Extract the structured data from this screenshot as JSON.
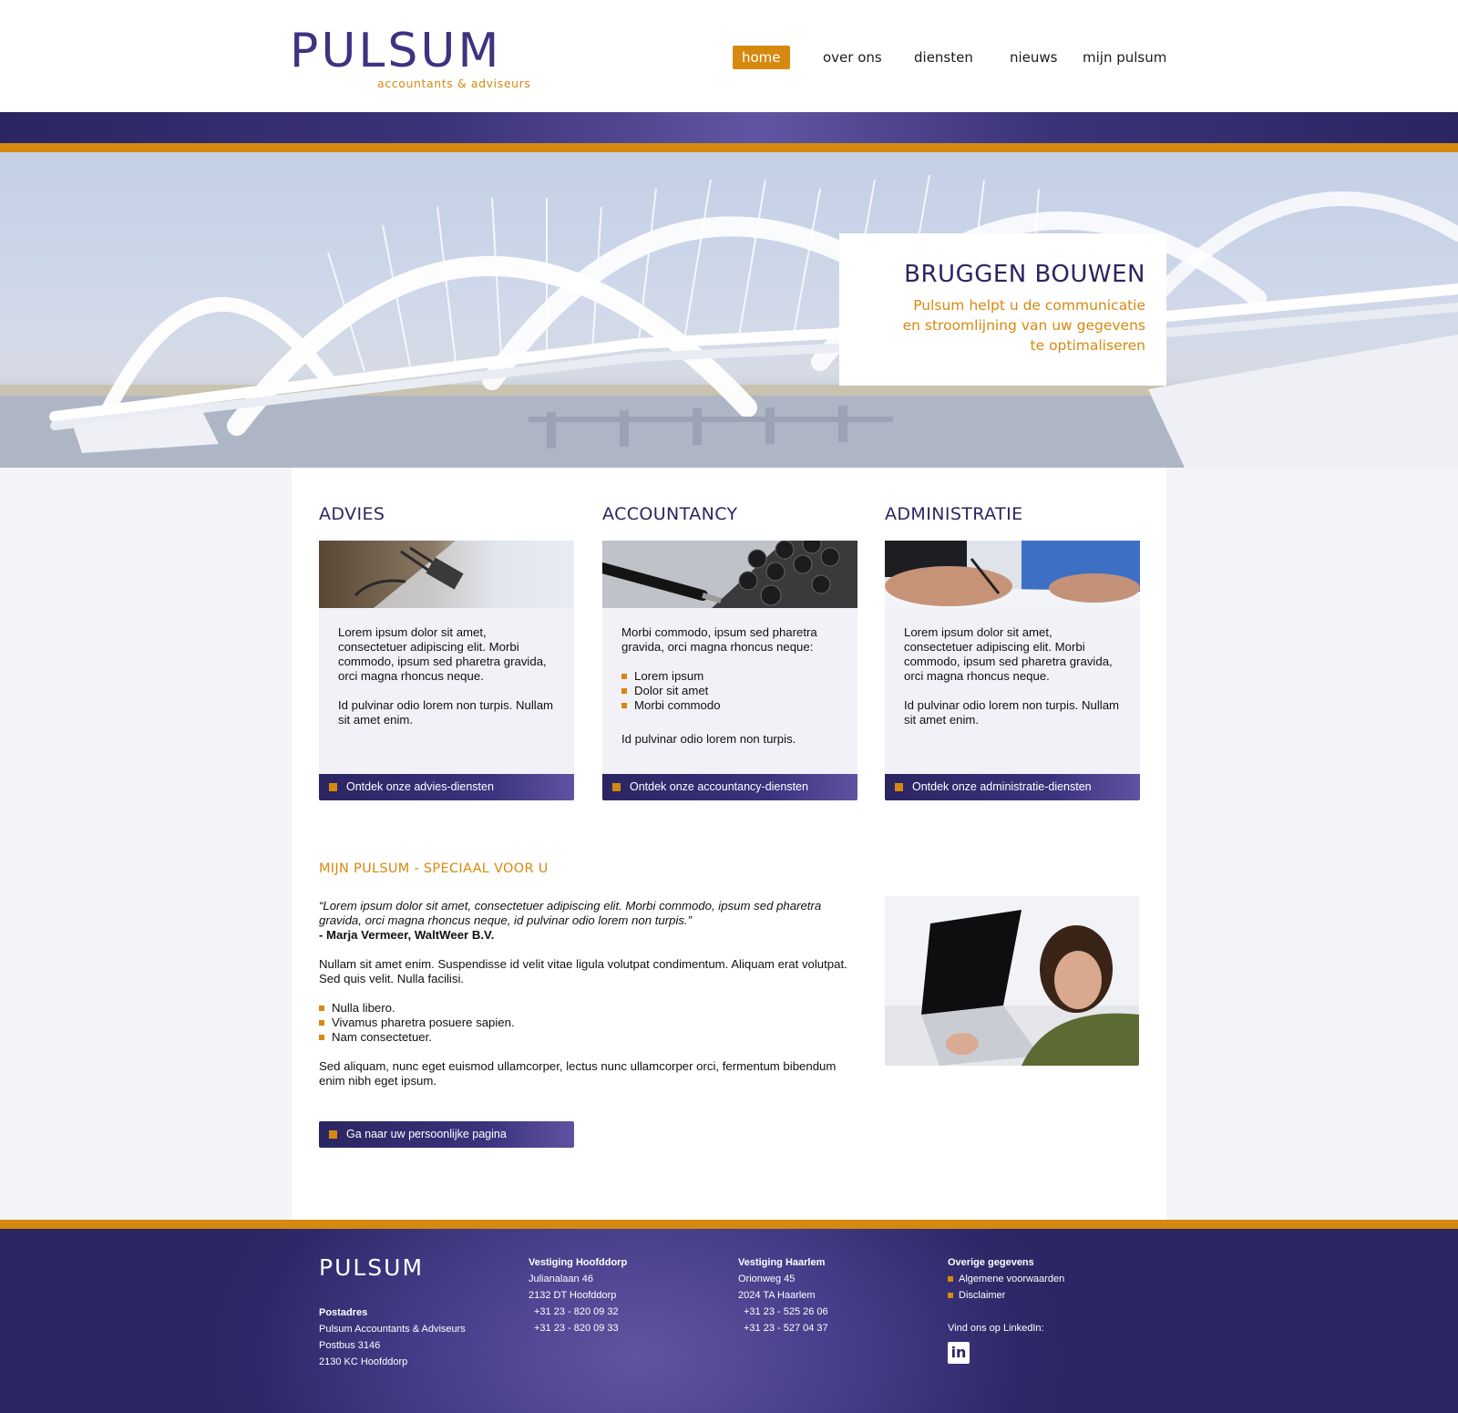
{
  "brand": {
    "name": "PULSUM",
    "tagline": "accountants & adviseurs",
    "colors": {
      "purple": "#2b2562",
      "orange": "#d68910",
      "panel": "#f1f1f7"
    }
  },
  "nav": {
    "items": [
      {
        "label": "home",
        "active": true
      },
      {
        "label": "over ons",
        "active": false
      },
      {
        "label": "diensten",
        "active": false
      },
      {
        "label": "nieuws",
        "active": false
      },
      {
        "label": "mijn pulsum",
        "active": false
      }
    ]
  },
  "hero": {
    "title": "BRUGGEN BOUWEN",
    "subtitle_lines": [
      "Pulsum helpt u de communicatie",
      "en stroomlijning van uw gegevens",
      "te optimaliseren"
    ]
  },
  "services": [
    {
      "title": "ADVIES",
      "image_icon": "paper-clip-photo",
      "paragraphs": [
        "Lorem ipsum dolor sit amet, consectetuer adipiscing elit. Morbi commodo, ipsum sed pharetra gravida, orci magna rhoncus neque.",
        "Id pulvinar odio lorem non turpis. Nullam sit amet enim."
      ],
      "button": "Ontdek onze advies-diensten"
    },
    {
      "title": "ACCOUNTANCY",
      "image_icon": "calculator-pen-photo",
      "intro": "Morbi commodo, ipsum sed pharetra gravida, orci magna rhoncus neque:",
      "bullets": [
        "Lorem ipsum",
        "Dolor sit amet",
        "Morbi commodo"
      ],
      "outro": "Id pulvinar odio lorem non turpis.",
      "button": "Ontdek onze accountancy-diensten"
    },
    {
      "title": "ADMINISTRATIE",
      "image_icon": "signing-document-photo",
      "paragraphs": [
        "Lorem ipsum dolor sit amet, consectetuer adipiscing elit. Morbi commodo, ipsum sed pharetra gravida, orci magna rhoncus neque.",
        "Id pulvinar odio lorem non turpis. Nullam sit amet enim."
      ],
      "button": "Ontdek onze administratie-diensten"
    }
  ],
  "mijn_pulsum": {
    "title": "MIJN PULSUM - SPECIAAL VOOR U",
    "quote": "“Lorem ipsum dolor sit amet, consectetuer adipiscing elit. Morbi commodo, ipsum sed pharetra gravida, orci magna rhoncus neque, id pulvinar odio lorem non turpis.”",
    "author": "- Marja Vermeer, WaltWeer B.V.",
    "paragraph1": "Nullam sit amet enim. Suspendisse id velit vitae ligula volutpat condimentum. Aliquam erat volutpat. Sed quis velit. Nulla facilisi.",
    "bullets": [
      "Nulla libero.",
      "Vivamus pharetra posuere sapien.",
      "Nam consectetuer."
    ],
    "paragraph2": "Sed aliquam, nunc eget euismod ullamcorper, lectus nunc ullamcorper orci, fermentum bibendum enim nibh eget ipsum.",
    "button": "Ga naar uw persoonlijke pagina"
  },
  "footer": {
    "logo": "PULSUM",
    "postadres": {
      "heading": "Postadres",
      "lines": [
        "Pulsum Accountants & Adviseurs",
        "Postbus 3146",
        "2130 KC Hoofddorp"
      ]
    },
    "hoofddorp": {
      "heading": "Vestiging Hoofddorp",
      "lines": [
        "Julianalaan 46",
        "2132 DT  Hoofddorp",
        "+31 23 - 820 09 32",
        "+31 23 - 820 09 33"
      ]
    },
    "haarlem": {
      "heading": "Vestiging Haarlem",
      "lines": [
        "Orionweg 45",
        "2024 TA  Haarlem",
        "+31 23 - 525 26 06",
        "+31 23 - 527 04 37"
      ]
    },
    "overige": {
      "heading": "Overige gegevens",
      "links": [
        "Algemene voorwaarden",
        "Disclaimer"
      ],
      "linkedin_label": "Vind ons op LinkedIn:",
      "linkedin_icon": "in"
    }
  }
}
